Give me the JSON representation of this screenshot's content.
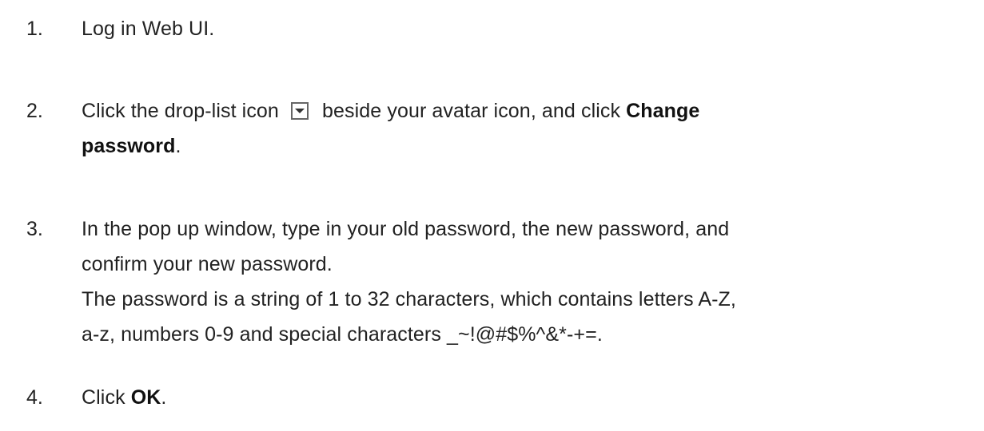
{
  "steps": [
    {
      "number": "1.",
      "text": "Log in Web UI."
    },
    {
      "number": "2.",
      "text_before_icon": "Click the drop-list icon",
      "icon": "drop-list-icon",
      "text_after_icon": "beside your avatar icon, and click",
      "bold_1": "Change",
      "bold_2": "password",
      "end": "."
    },
    {
      "number": "3.",
      "line_1": "In the pop up window, type in your old password, the new password, and",
      "line_2": "confirm your new password.",
      "line_3": "The password is a string of 1 to 32 characters, which contains letters A-Z,",
      "line_4": "a-z, numbers 0-9 and special characters _~!@#$%^&*-+=."
    },
    {
      "number": "4.",
      "text": "Click",
      "bold": "OK",
      "end": "."
    }
  ]
}
